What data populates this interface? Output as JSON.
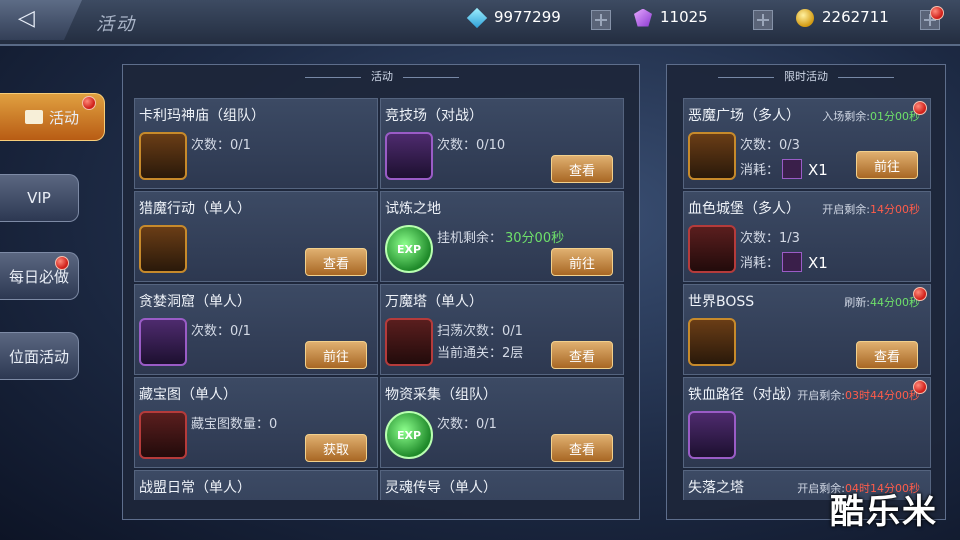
{
  "header": {
    "back": "◁",
    "title": "活动"
  },
  "currency": {
    "diamond": "9977299",
    "crystal": "11025",
    "gold": "2262711"
  },
  "side_tabs": [
    {
      "label": "活动",
      "active": true,
      "badge": true
    },
    {
      "label": "VIP",
      "active": false,
      "badge": false
    },
    {
      "label": "每日必做",
      "active": false,
      "badge": true
    },
    {
      "label": "位面活动",
      "active": false,
      "badge": false
    }
  ],
  "left_section": "活动",
  "right_section": "限时活动",
  "activities": [
    {
      "title": "卡利玛神庙（组队）",
      "lines": [
        "次数：0/1"
      ],
      "icon": "chest-icon",
      "button": ""
    },
    {
      "title": "竞技场（对战）",
      "lines": [
        "次数：0/10"
      ],
      "icon": "arena-icon",
      "button": "查看"
    },
    {
      "title": "猎魔行动（单人）",
      "lines": [],
      "icon": "dragon-icon",
      "button": "查看"
    },
    {
      "title": "试炼之地",
      "lines": [
        "挂机剩余：",
        "30分00秒"
      ],
      "icon": "exp-icon",
      "icon_text": "EXP",
      "button": "前往"
    },
    {
      "title": "贪婪洞窟（单人）",
      "lines": [
        "次数：0/1"
      ],
      "icon": "gold-pile-icon",
      "button": "前往"
    },
    {
      "title": "万魔塔（单人）",
      "lines": [
        "扫荡次数：0/1",
        "当前通关：2层"
      ],
      "icon": "tower-icon",
      "button": "查看"
    },
    {
      "title": "藏宝图（单人）",
      "lines": [
        "藏宝图数量：0"
      ],
      "icon": "crystal-icon",
      "button": "获取"
    },
    {
      "title": "物资采集（组队）",
      "lines": [
        "次数：0/1"
      ],
      "icon": "exp-icon",
      "icon_text": "EXP",
      "button": "查看"
    },
    {
      "title": "战盟日常（单人）"
    },
    {
      "title": "灵魂传导（单人）"
    }
  ],
  "limited": [
    {
      "title": "恶魔广场（多人）",
      "hint_label": "入场剩余:",
      "hint_time": "01分00秒",
      "hint_color": "green",
      "lines": [
        "次数：0/3",
        "消耗："
      ],
      "cost": "X1",
      "button": "前往",
      "badge": true
    },
    {
      "title": "血色城堡（多人）",
      "hint_label": "开启剩余:",
      "hint_time": "14分00秒",
      "hint_color": "red",
      "lines": [
        "次数：1/3",
        "消耗："
      ],
      "cost": "X1",
      "button": "",
      "badge": false
    },
    {
      "title": "世界BOSS",
      "hint_label": "刷新:",
      "hint_time": "44分00秒",
      "hint_color": "green",
      "lines": [],
      "cost": "",
      "button": "查看",
      "badge": true
    },
    {
      "title": "铁血路径（对战）",
      "hint_label": "开启剩余:",
      "hint_time": "03时44分00秒",
      "hint_color": "red",
      "lines": [],
      "cost": "",
      "button": "",
      "badge": true
    },
    {
      "title": "失落之塔",
      "hint_label": "开启剩余:",
      "hint_time": "04时14分00秒",
      "hint_color": "red"
    }
  ],
  "watermark": "酷乐米"
}
